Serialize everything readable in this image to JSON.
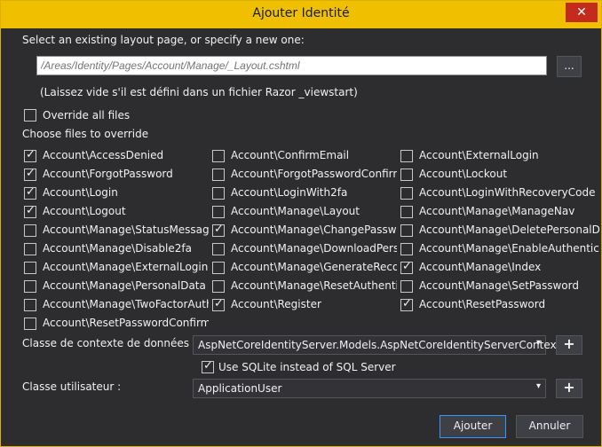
{
  "window": {
    "title": "Ajouter Identité",
    "close_glyph": "✕"
  },
  "layout": {
    "label": "Select an existing layout page, or specify a new one:",
    "placeholder": "/Areas/Identity/Pages/Account/Manage/_Layout.cshtml",
    "browse_label": "...",
    "hint": "(Laissez vide s'il est défini dans un fichier Razor _viewstart)"
  },
  "override_all": {
    "label": "Override all files",
    "checked": false
  },
  "choose_label": "Choose files to override",
  "files": [
    [
      {
        "label": "Account\\AccessDenied",
        "checked": true
      },
      {
        "label": "Account\\ForgotPassword",
        "checked": true
      },
      {
        "label": "Account\\Login",
        "checked": true
      },
      {
        "label": "Account\\Logout",
        "checked": true
      },
      {
        "label": "Account\\Manage\\StatusMessage",
        "checked": false
      },
      {
        "label": "Account\\Manage\\Disable2fa",
        "checked": false
      },
      {
        "label": "Account\\Manage\\ExternalLogins",
        "checked": false
      },
      {
        "label": "Account\\Manage\\PersonalData",
        "checked": false
      },
      {
        "label": "Account\\Manage\\TwoFactorAuthe",
        "checked": false
      },
      {
        "label": "Account\\ResetPasswordConfirmati",
        "checked": false
      }
    ],
    [
      {
        "label": "Account\\ConfirmEmail",
        "checked": false
      },
      {
        "label": "Account\\ForgotPasswordConfirma",
        "checked": false
      },
      {
        "label": "Account\\LoginWith2fa",
        "checked": false
      },
      {
        "label": "Account\\Manage\\Layout",
        "checked": false
      },
      {
        "label": "Account\\Manage\\ChangePasswo",
        "checked": true
      },
      {
        "label": "Account\\Manage\\DownloadPersor",
        "checked": false
      },
      {
        "label": "Account\\Manage\\GenerateRecove",
        "checked": false
      },
      {
        "label": "Account\\Manage\\ResetAuthentica",
        "checked": false
      },
      {
        "label": "Account\\Register",
        "checked": true
      }
    ],
    [
      {
        "label": "Account\\ExternalLogin",
        "checked": false
      },
      {
        "label": "Account\\Lockout",
        "checked": false
      },
      {
        "label": "Account\\LoginWithRecoveryCode",
        "checked": false
      },
      {
        "label": "Account\\Manage\\ManageNav",
        "checked": false
      },
      {
        "label": "Account\\Manage\\DeletePersonalD",
        "checked": false
      },
      {
        "label": "Account\\Manage\\EnableAuthentic",
        "checked": false
      },
      {
        "label": "Account\\Manage\\Index",
        "checked": true
      },
      {
        "label": "Account\\Manage\\SetPassword",
        "checked": false
      },
      {
        "label": "Account\\ResetPassword",
        "checked": true
      }
    ]
  ],
  "data_context": {
    "label": "Classe de contexte de données :",
    "value": "AspNetCoreIdentityServer.Models.AspNetCoreIdentityServerContext",
    "add_label": "+"
  },
  "sqlite": {
    "label": "Use SQLite instead of SQL Server",
    "checked": true
  },
  "user_class": {
    "label": "Classe utilisateur :",
    "value": "ApplicationUser",
    "add_label": "+"
  },
  "actions": {
    "add_label": "Ajouter",
    "cancel_label": "Annuler"
  }
}
